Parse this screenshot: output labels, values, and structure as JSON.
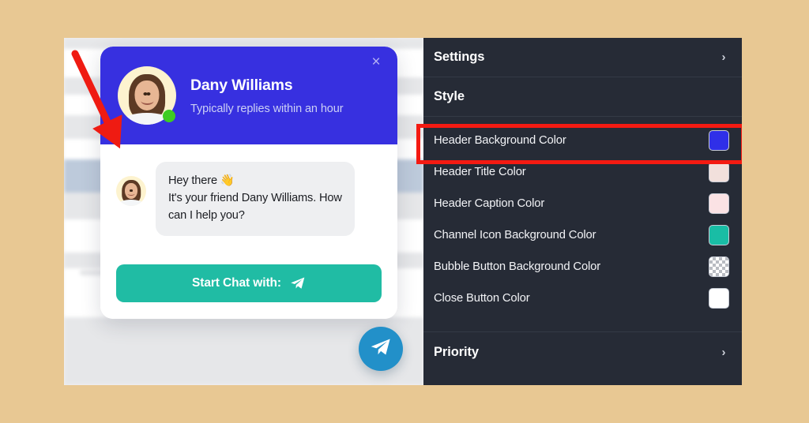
{
  "canvas": {
    "background_color": "#e8c893"
  },
  "chat_widget": {
    "header": {
      "background_color": "#3730e0",
      "agent_name": "Dany Williams",
      "caption": "Typically replies within an hour",
      "close_icon": "close-icon",
      "close_glyph": "×",
      "status": "online",
      "status_color": "#3ecc22"
    },
    "message": {
      "avatar": "agent-avatar",
      "line1": "Hey there 👋",
      "line2": "It's your friend Dany Williams. How",
      "line3": "can I help you?",
      "bubble_color": "#eeeff1"
    },
    "start_button": {
      "label": "Start Chat with:",
      "icon": "telegram-plane-icon",
      "background_color": "#20bca4",
      "text_color": "#ffffff"
    },
    "bubble_button": {
      "icon": "telegram-plane-icon",
      "background_color": "#2290c9"
    }
  },
  "settings_panel": {
    "background_color": "#262b36",
    "sections": [
      {
        "label": "Settings",
        "chevron": "chevron-right-icon",
        "glyph": "›",
        "expanded": false
      },
      {
        "label": "Style",
        "chevron": "chevron-down-icon",
        "glyph": "ⱟ",
        "expanded": true
      }
    ],
    "style_options": [
      {
        "label": "Header Background Color",
        "swatch_color": "#2f2fe8",
        "swatch_type": "solid",
        "highlighted": true
      },
      {
        "label": "Header Title Color",
        "swatch_color": "#f2e0dc",
        "swatch_type": "solid",
        "highlighted": false
      },
      {
        "label": "Header Caption Color",
        "swatch_color": "#fbe2e4",
        "swatch_type": "solid",
        "highlighted": false
      },
      {
        "label": "Channel Icon Background Color",
        "swatch_color": "#19bda5",
        "swatch_type": "solid",
        "highlighted": false
      },
      {
        "label": "Bubble Button Background Color",
        "swatch_color": "transparent",
        "swatch_type": "checkerboard",
        "highlighted": false
      },
      {
        "label": "Close Button Color",
        "swatch_color": "#ffffff",
        "swatch_type": "solid",
        "highlighted": false
      }
    ],
    "footer_sections": [
      {
        "label": "Priority",
        "chevron": "chevron-right-icon",
        "glyph": "›",
        "expanded": false
      }
    ]
  },
  "annotations": {
    "highlight_box_color": "#f41a12",
    "arrow_color": "#ef1b12",
    "arrow_target": "Header Background Color row / widget header"
  }
}
